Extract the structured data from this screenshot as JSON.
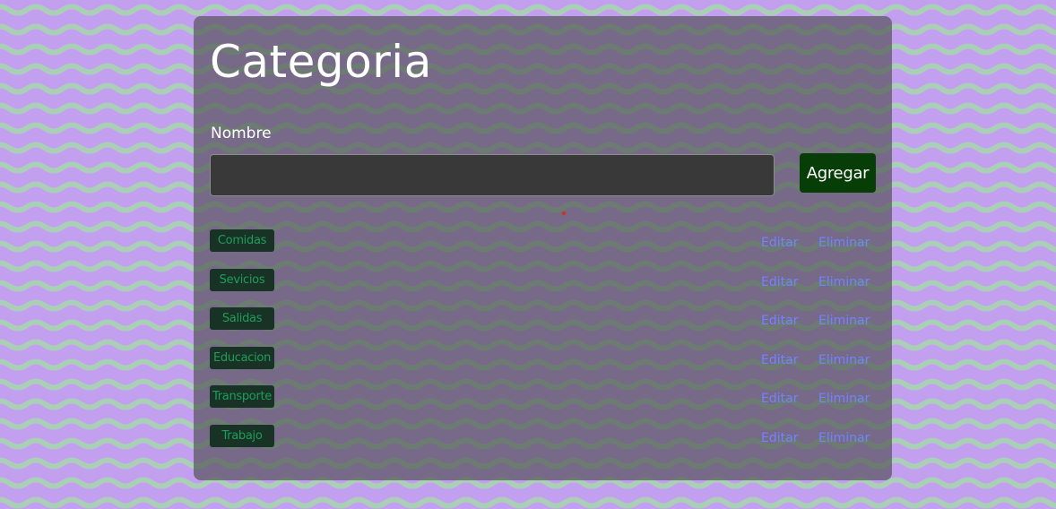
{
  "page": {
    "title": "Categoria",
    "field_label": "Nombre",
    "name_input": {
      "value": "",
      "placeholder": ""
    },
    "add_button_label": "Agregar"
  },
  "categories": [
    {
      "name": "Comidas",
      "edit_label": "Editar",
      "delete_label": "Eliminar"
    },
    {
      "name": "Sevicios",
      "edit_label": "Editar",
      "delete_label": "Eliminar"
    },
    {
      "name": "Salidas",
      "edit_label": "Editar",
      "delete_label": "Eliminar"
    },
    {
      "name": "Educacion",
      "edit_label": "Editar",
      "delete_label": "Eliminar"
    },
    {
      "name": "Transporte",
      "edit_label": "Editar",
      "delete_label": "Eliminar"
    },
    {
      "name": "Trabajo",
      "edit_label": "Editar",
      "delete_label": "Eliminar"
    }
  ],
  "colors": {
    "background": "#c39ff0",
    "wave": "#a9cfb6",
    "panel": "#4a4a4a",
    "add_button": "#073d07",
    "badge_bg": "#183226",
    "badge_text": "#1f9d5a",
    "link": "#6f84ff"
  }
}
